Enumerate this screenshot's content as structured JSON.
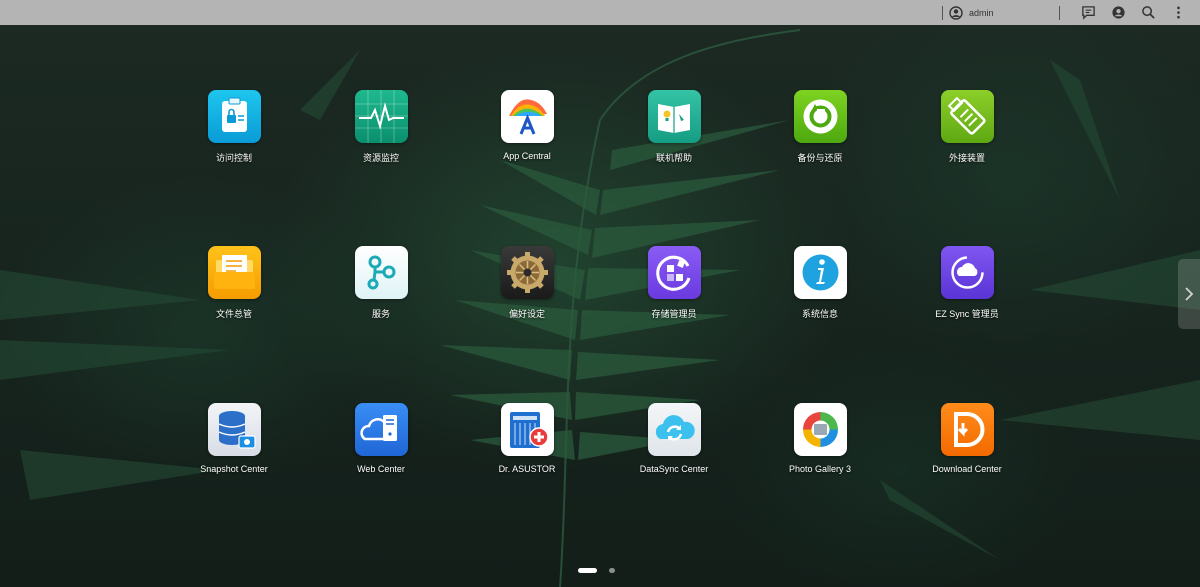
{
  "topbar": {
    "user_name": "admin",
    "icons": [
      "user-icon",
      "message-icon",
      "account-icon",
      "search-icon",
      "more-icon"
    ]
  },
  "apps": [
    {
      "label": "访问控制",
      "icon": "access-control-icon"
    },
    {
      "label": "资源监控",
      "icon": "activity-monitor-icon"
    },
    {
      "label": "App Central",
      "icon": "app-central-icon"
    },
    {
      "label": "联机帮助",
      "icon": "online-help-icon"
    },
    {
      "label": "备份与还原",
      "icon": "backup-restore-icon"
    },
    {
      "label": "外接装置",
      "icon": "external-devices-icon"
    },
    {
      "label": "文件总管",
      "icon": "file-explorer-icon"
    },
    {
      "label": "服务",
      "icon": "services-icon"
    },
    {
      "label": "偏好设定",
      "icon": "settings-icon"
    },
    {
      "label": "存储管理员",
      "icon": "storage-manager-icon"
    },
    {
      "label": "系统信息",
      "icon": "system-information-icon"
    },
    {
      "label": "EZ Sync 管理员",
      "icon": "ez-sync-icon"
    },
    {
      "label": "Snapshot Center",
      "icon": "snapshot-center-icon"
    },
    {
      "label": "Web Center",
      "icon": "web-center-icon"
    },
    {
      "label": "Dr. ASUSTOR",
      "icon": "dr-asustor-icon"
    },
    {
      "label": "DataSync Center",
      "icon": "datasync-center-icon"
    },
    {
      "label": "Photo Gallery 3",
      "icon": "photo-gallery-icon"
    },
    {
      "label": "Download Center",
      "icon": "download-center-icon"
    }
  ],
  "pager": {
    "pages": 2,
    "current": 1
  },
  "colors": {
    "topbar": "#b4b4b4",
    "label": "#ffffff"
  }
}
